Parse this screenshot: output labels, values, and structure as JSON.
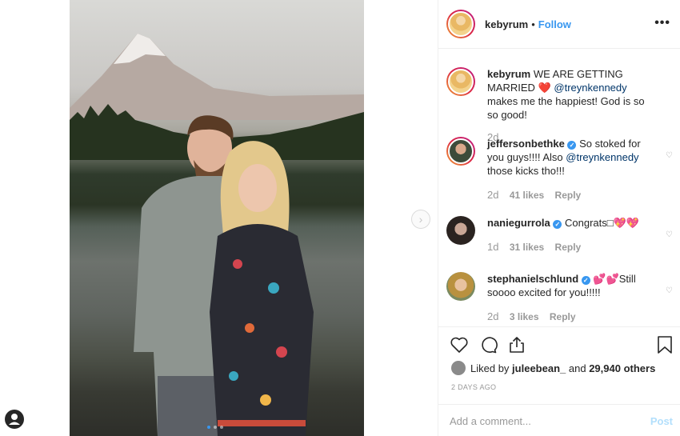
{
  "post": {
    "username": "kebyrum",
    "separator": "•",
    "follow_label": "Follow",
    "more_label": "•••",
    "caption": {
      "username": "kebyrum",
      "text_1": "WE ARE GETTING MARRIED",
      "emoji": "❤️",
      "mention": "@treynkennedy",
      "text_2": "makes me the happiest! God is so so good!",
      "time": "2d"
    },
    "comments": [
      {
        "username": "jeffersonbethke",
        "verified": true,
        "text_1": "So stoked for you guys!!!! Also",
        "mention": "@treynkennedy",
        "text_2": "those kicks tho!!!",
        "time": "2d",
        "likes": "41 likes",
        "reply": "Reply"
      },
      {
        "username": "naniegurrola",
        "verified": true,
        "text_1": "Congrats□💖💖",
        "time": "1d",
        "likes": "31 likes",
        "reply": "Reply"
      },
      {
        "username": "stephanielschlund",
        "verified": true,
        "text_1": "💕💕Still soooo excited for you!!!!!",
        "time": "2d",
        "likes": "3 likes",
        "reply": "Reply"
      }
    ],
    "liked_by": {
      "prefix": "Liked by",
      "user": "juleebean_",
      "middle": "and",
      "count": "29,940 others"
    },
    "date": "2 DAYS AGO",
    "add_comment_placeholder": "Add a comment...",
    "post_button": "Post",
    "carousel": {
      "count": 3,
      "active": 1
    }
  },
  "colors": {
    "link": "#3897f0",
    "mention": "#003569",
    "muted": "#999999",
    "post_disabled": "#b2dffc"
  },
  "icons": {
    "like": "heart-icon",
    "comment": "comment-bubble-icon",
    "share": "share-icon",
    "save": "bookmark-icon",
    "more": "more-dots-icon",
    "next": "chevron-right-icon",
    "verified": "verified-badge-icon"
  }
}
